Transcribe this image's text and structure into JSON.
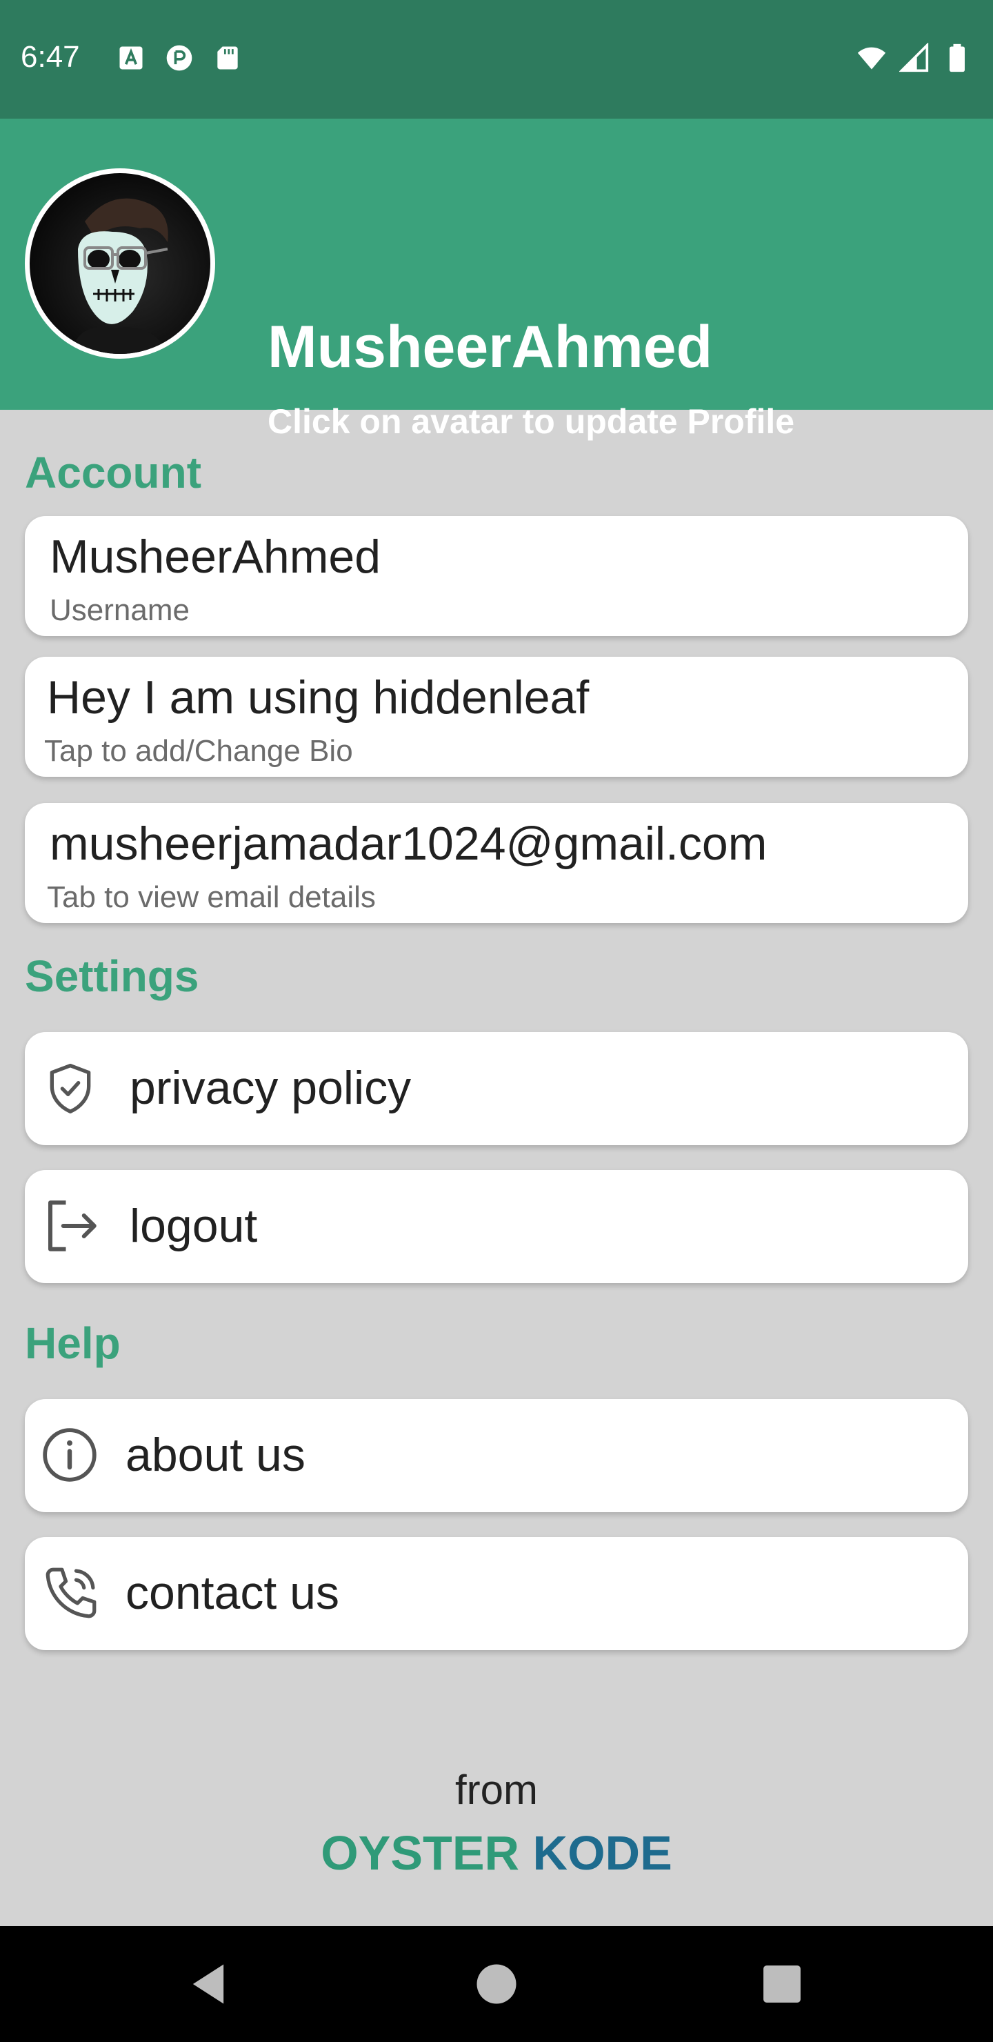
{
  "status_bar": {
    "time": "6:47",
    "left_icons": [
      "a-notification-icon",
      "p-notification-icon",
      "sd-card-icon"
    ],
    "right_icons": [
      "wifi-icon",
      "signal-icon",
      "battery-icon"
    ]
  },
  "header": {
    "name": "MusheerAhmed",
    "subtitle": "Click on avatar to update Profile"
  },
  "sections": {
    "account": "Account",
    "settings": "Settings",
    "help": "Help"
  },
  "account": {
    "username_value": "MusheerAhmed",
    "username_label": "Username",
    "bio_value": "Hey I am using hiddenleaf",
    "bio_label": "Tap to add/Change Bio",
    "email_value": "musheerjamadar1024@gmail.com",
    "email_label": "Tab to view email details"
  },
  "settings": {
    "privacy_label": "privacy policy",
    "logout_label": "logout"
  },
  "help": {
    "about_label": "about us",
    "contact_label": "contact us"
  },
  "footer": {
    "from": "from",
    "brand_part1": "OYSTER",
    "brand_part2": "KODE"
  },
  "colors": {
    "status_bar": "#2e7b5e",
    "header": "#3ba27c",
    "accent": "#3ba27c",
    "background": "#d3d3d3",
    "brand_blue": "#1e6b8e"
  }
}
